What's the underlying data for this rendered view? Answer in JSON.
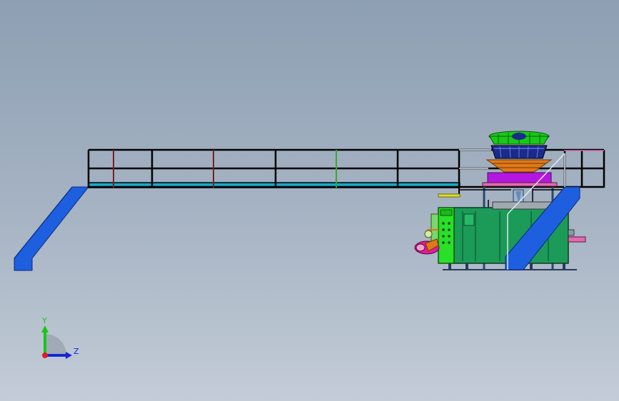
{
  "view": {
    "background_top": "#8d9fb3",
    "background_bottom": "#c3ccd7"
  },
  "triad": {
    "y_label": "Y",
    "z_label": "Z",
    "y_color": "#14c814",
    "z_color": "#1428d2",
    "x_color": "#e01c1c"
  },
  "model": {
    "colors": {
      "frame": "#000000",
      "stairs": "#1e5fe0",
      "deck": "#18a8c8",
      "hopper_top": "#18c818",
      "bucket_ring": "#1c2a8a",
      "cone": "#e07818",
      "feeder": "#b418e0",
      "cabinet": "#1c9a58",
      "control_panel": "#28e028",
      "film_roll": "#e01c9a",
      "handrail_pink": "#e06ab4"
    }
  }
}
